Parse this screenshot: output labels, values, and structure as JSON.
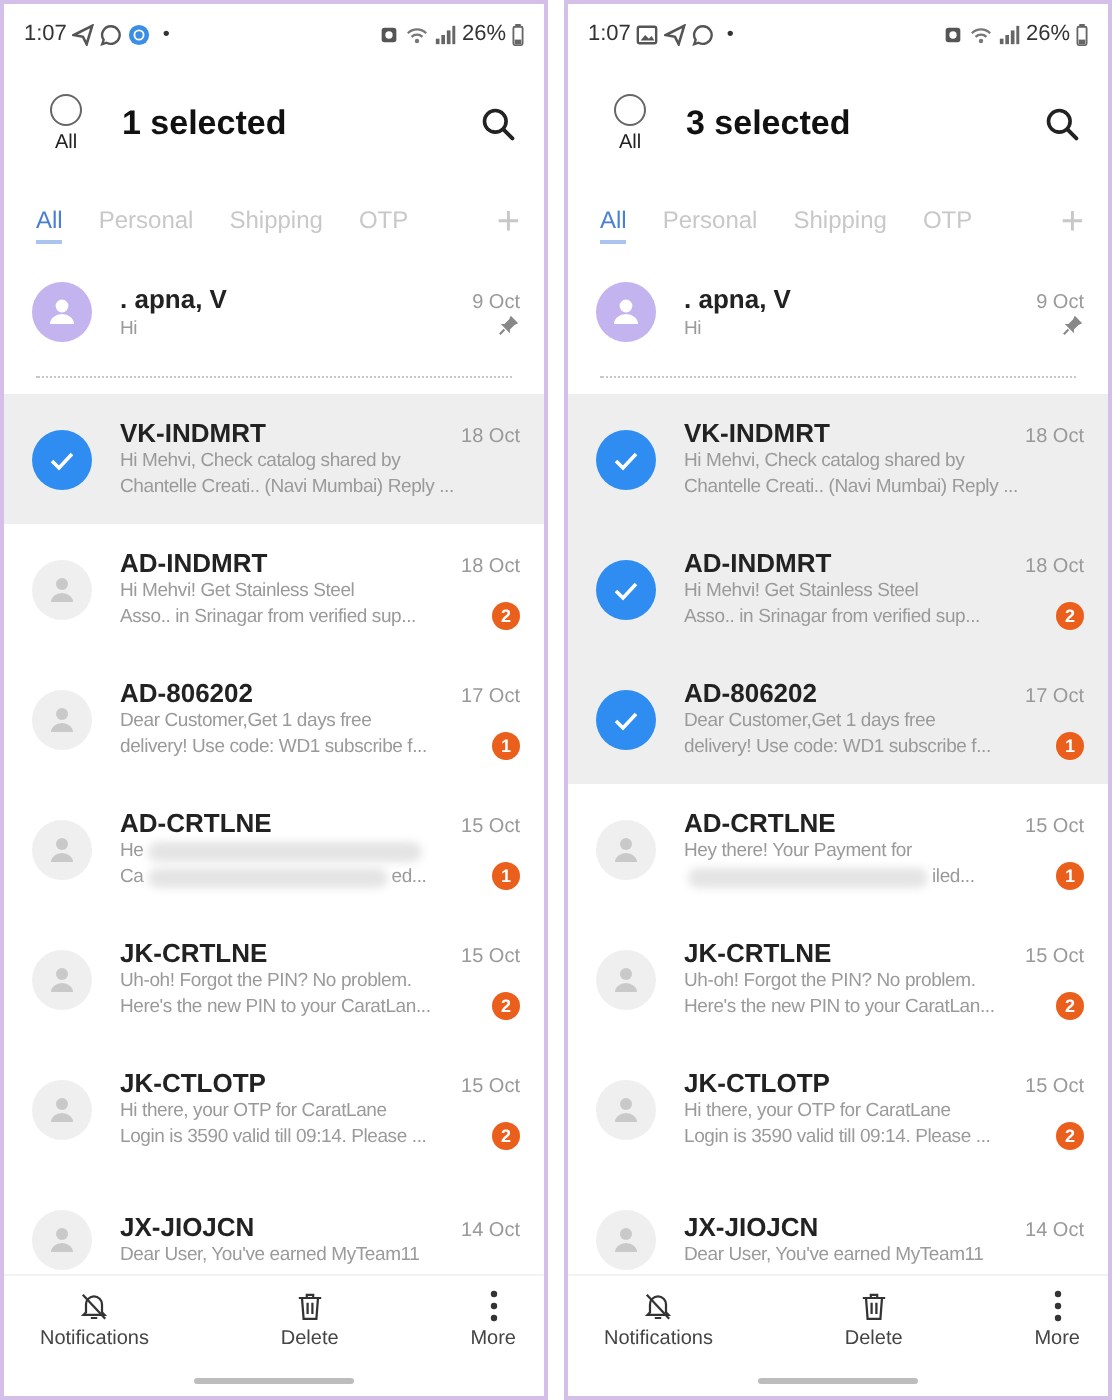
{
  "screens": [
    {
      "status_bar": {
        "time": "1:07",
        "notification_icons": [
          {
            "kind": "send"
          },
          {
            "kind": "chat"
          },
          {
            "kind": "app"
          }
        ],
        "dot": "•",
        "battery": "26%"
      },
      "header": {
        "select_all": {
          "label": "All",
          "checked": false
        },
        "title": "1 selected"
      },
      "tabs": [
        {
          "label": "All",
          "selected": true
        },
        {
          "label": "Personal",
          "selected": false
        },
        {
          "label": "Shipping",
          "selected": false
        },
        {
          "label": "OTP",
          "selected": false
        }
      ],
      "add_tab": "+",
      "pinned": {
        "name": ". apna, V",
        "preview": "Hi",
        "date": "9 Oct",
        "pinned": true
      },
      "messages": [
        {
          "name": "VK-INDMRT",
          "date": "18 Oct",
          "selected": true,
          "lines": [
            [
              {
                "text": "Hi Mehvi, Check catalog shared by"
              }
            ],
            [
              {
                "text": "Chantelle Creati.. (Navi Mumbai)  Reply ..."
              }
            ]
          ]
        },
        {
          "name": "AD-INDMRT",
          "date": "18 Oct",
          "selected": false,
          "badge": "2",
          "lines": [
            [
              {
                "text": "Hi Mehvi! Get Stainless Steel"
              }
            ],
            [
              {
                "text": "Asso.. in Srinagar from verified sup..."
              }
            ]
          ]
        },
        {
          "name": "AD-806202",
          "date": "17 Oct",
          "selected": false,
          "badge": "1",
          "lines": [
            [
              {
                "text": "Dear Customer,Get 1 days free"
              }
            ],
            [
              {
                "text": "delivery! Use code: WD1 subscribe f..."
              }
            ]
          ]
        },
        {
          "name": "AD-CRTLNE",
          "date": "15 Oct",
          "selected": false,
          "badge": "1",
          "lines": [
            [
              {
                "text": "He"
              },
              {
                "kind": "blur"
              }
            ],
            [
              {
                "text": "Ca"
              },
              {
                "kind": "blur"
              },
              {
                "text": "ed..."
              }
            ]
          ]
        },
        {
          "name": "JK-CRTLNE",
          "date": "15 Oct",
          "selected": false,
          "badge": "2",
          "lines": [
            [
              {
                "text": "Uh-oh! Forgot the PIN? No problem."
              }
            ],
            [
              {
                "text": "Here's the new PIN to your CaratLan..."
              }
            ]
          ]
        },
        {
          "name": "JK-CTLOTP",
          "date": "15 Oct",
          "selected": false,
          "badge": "2",
          "lines": [
            [
              {
                "text": "Hi there, your OTP for CaratLane"
              }
            ],
            [
              {
                "text": "Login is 3590 valid till 09:14. Please ..."
              }
            ]
          ]
        },
        {
          "name": "JX-JIOJCN",
          "date": "14 Oct",
          "selected": false,
          "lines": [
            [
              {
                "text": "Dear User,  You've earned MyTeam11"
              }
            ]
          ]
        }
      ],
      "actions": [
        {
          "label": "Notifications",
          "kind": "mute"
        },
        {
          "label": "Delete",
          "kind": "delete"
        },
        {
          "label": "More",
          "kind": "more"
        }
      ]
    },
    {
      "status_bar": {
        "time": "1:07",
        "notification_icons": [
          {
            "kind": "image"
          },
          {
            "kind": "send"
          },
          {
            "kind": "chat"
          }
        ],
        "dot": "•",
        "battery": "26%"
      },
      "header": {
        "select_all": {
          "label": "All",
          "checked": false
        },
        "title": "3 selected"
      },
      "tabs": [
        {
          "label": "All",
          "selected": true
        },
        {
          "label": "Personal",
          "selected": false
        },
        {
          "label": "Shipping",
          "selected": false
        },
        {
          "label": "OTP",
          "selected": false
        }
      ],
      "add_tab": "+",
      "pinned": {
        "name": ". apna, V",
        "preview": "Hi",
        "date": "9 Oct",
        "pinned": true
      },
      "messages": [
        {
          "name": "VK-INDMRT",
          "date": "18 Oct",
          "selected": true,
          "lines": [
            [
              {
                "text": "Hi Mehvi, Check catalog shared by"
              }
            ],
            [
              {
                "text": "Chantelle Creati.. (Navi Mumbai)  Reply ..."
              }
            ]
          ]
        },
        {
          "name": "AD-INDMRT",
          "date": "18 Oct",
          "selected": true,
          "badge": "2",
          "lines": [
            [
              {
                "text": "Hi Mehvi! Get Stainless Steel"
              }
            ],
            [
              {
                "text": "Asso.. in Srinagar from verified sup..."
              }
            ]
          ]
        },
        {
          "name": "AD-806202",
          "date": "17 Oct",
          "selected": true,
          "badge": "1",
          "lines": [
            [
              {
                "text": "Dear Customer,Get 1 days free"
              }
            ],
            [
              {
                "text": "delivery! Use code: WD1 subscribe f..."
              }
            ]
          ]
        },
        {
          "name": "AD-CRTLNE",
          "date": "15 Oct",
          "selected": false,
          "badge": "1",
          "lines": [
            [
              {
                "text": "Hey there! Your Payment for"
              }
            ],
            [
              {
                "kind": "blur"
              },
              {
                "text": "iled..."
              }
            ]
          ]
        },
        {
          "name": "JK-CRTLNE",
          "date": "15 Oct",
          "selected": false,
          "badge": "2",
          "lines": [
            [
              {
                "text": "Uh-oh! Forgot the PIN? No problem."
              }
            ],
            [
              {
                "text": "Here's the new PIN to your CaratLan..."
              }
            ]
          ]
        },
        {
          "name": "JK-CTLOTP",
          "date": "15 Oct",
          "selected": false,
          "badge": "2",
          "lines": [
            [
              {
                "text": "Hi there, your OTP for CaratLane"
              }
            ],
            [
              {
                "text": "Login is 3590 valid till 09:14. Please ..."
              }
            ]
          ]
        },
        {
          "name": "JX-JIOJCN",
          "date": "14 Oct",
          "selected": false,
          "lines": [
            [
              {
                "text": "Dear User,  You've earned MyTeam11"
              }
            ]
          ]
        }
      ],
      "actions": [
        {
          "label": "Notifications",
          "kind": "mute"
        },
        {
          "label": "Delete",
          "kind": "delete"
        },
        {
          "label": "More",
          "kind": "more"
        }
      ]
    }
  ]
}
